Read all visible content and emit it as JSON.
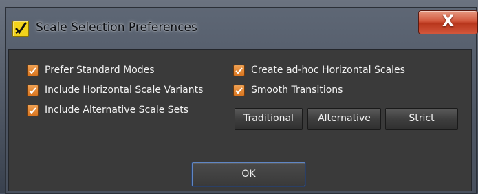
{
  "window": {
    "title": "Scale Selection Preferences",
    "close_label": "X"
  },
  "options": {
    "left": [
      {
        "label": "Prefer Standard Modes",
        "checked": true
      },
      {
        "label": "Include Horizontal Scale Variants",
        "checked": true
      },
      {
        "label": "Include Alternative Scale Sets",
        "checked": true
      }
    ],
    "right": [
      {
        "label": "Create ad-hoc Horizontal Scales",
        "checked": true
      },
      {
        "label": "Smooth Transitions",
        "checked": true
      }
    ]
  },
  "presets": {
    "traditional": "Traditional",
    "alternative": "Alternative",
    "strict": "Strict"
  },
  "footer": {
    "ok_label": "OK"
  },
  "colors": {
    "checkbox": "#e08a35",
    "client_bg": "#3a3a3a",
    "close_button": "#c94a2f",
    "ok_focus_border": "#5f86c4"
  },
  "icons": {
    "app": "app-logo-icon",
    "check": "checkmark-icon",
    "close": "close-icon"
  }
}
